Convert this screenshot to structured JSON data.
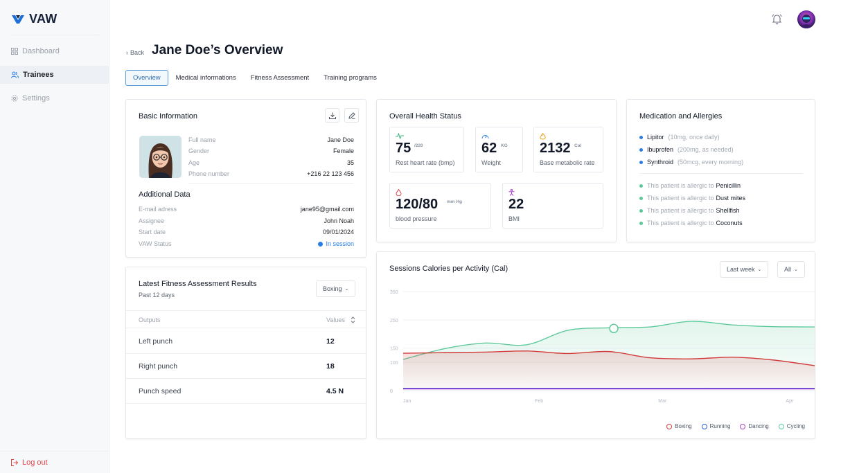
{
  "app": {
    "name": "VAW"
  },
  "sidebar": {
    "items": [
      {
        "label": "Dashboard",
        "icon": "grid-icon",
        "active": false
      },
      {
        "label": "Trainees",
        "icon": "users-icon",
        "active": true
      },
      {
        "label": "Settings",
        "icon": "gear-icon",
        "active": false
      }
    ],
    "logout": "Log out"
  },
  "header": {
    "back": "Back",
    "title": "Jane Doe’s Overview"
  },
  "tabs": [
    "Overview",
    "Medical informations",
    "Fitness Assessment",
    "Training programs"
  ],
  "basic_info": {
    "title": "Basic Information",
    "fields": [
      {
        "k": "Full name",
        "v": "Jane Doe"
      },
      {
        "k": "Gender",
        "v": "Female"
      },
      {
        "k": "Age",
        "v": "35"
      },
      {
        "k": "Phone number",
        "v": "+216 22 123 456"
      }
    ],
    "additional_title": "Additional Data",
    "additional": [
      {
        "k": "E-mail adress",
        "v": "jane95@gmail.com"
      },
      {
        "k": "Assignee",
        "v": "John Noah"
      },
      {
        "k": "Start date",
        "v": "09/01/2024"
      },
      {
        "k": "VAW Status",
        "v": "In session"
      }
    ]
  },
  "health": {
    "title": "Overall Health Status",
    "metrics": [
      {
        "value": "75",
        "unit": "/220",
        "label": "Rest heart rate (bmp)",
        "icon": "heartbeat-icon",
        "color": "#3bb57a"
      },
      {
        "value": "62",
        "unit": "KG",
        "label": "Weight",
        "icon": "gauge-icon",
        "color": "#2a7de1"
      },
      {
        "value": "2132",
        "unit": "Cal",
        "label": "Base metabolic rate",
        "icon": "flame-icon",
        "color": "#f0a020"
      },
      {
        "value": "120/80",
        "unit": "mm Hg",
        "label": "blood pressure",
        "icon": "drop-icon",
        "color": "#e0464a"
      },
      {
        "value": "22",
        "unit": "",
        "label": "BMI",
        "icon": "person-icon",
        "color": "#b044d0"
      }
    ]
  },
  "medication": {
    "title": "Medication and Allergies",
    "meds": [
      {
        "name": "Lipitor",
        "note": "(10mg, once daily)"
      },
      {
        "name": "Ibuprofen",
        "note": "(200mg, as needed)"
      },
      {
        "name": "Synthroid",
        "note": "(50mcg, every morning)"
      }
    ],
    "allergy_prefix": "This patient is allergic to",
    "allergies": [
      "Penicillin",
      "Dust mites",
      "Shellfish",
      "Coconuts"
    ]
  },
  "fitness": {
    "title": "Latest Fitness Assessment Results",
    "subtitle": "Past 12 days",
    "filter": "Boxing",
    "col_outputs": "Outputs",
    "col_values": "Values",
    "rows": [
      {
        "o": "Left punch",
        "v": "12"
      },
      {
        "o": "Right punch",
        "v": "18"
      },
      {
        "o": "Punch speed",
        "v": "4.5 N"
      }
    ]
  },
  "sessions": {
    "title": "Sessions Calories per Activity (Cal)",
    "period": "Last week",
    "activity": "All"
  },
  "chart_data": {
    "type": "area",
    "title": "Sessions Calories per Activity (Cal)",
    "x_ticks": [
      "Jan",
      "Feb",
      "Mar",
      "Apr"
    ],
    "y_ticks": [
      0,
      100,
      150,
      250,
      350
    ],
    "ylim": [
      0,
      350
    ],
    "x": [
      0,
      0.1,
      0.2,
      0.3,
      0.4,
      0.5,
      0.6,
      0.7,
      0.8,
      0.9,
      1.0
    ],
    "series": [
      {
        "name": "Boxing",
        "color": "#d23b3b",
        "values": [
          132,
          134,
          136,
          140,
          131,
          138,
          116,
          112,
          118,
          108,
          88
        ]
      },
      {
        "name": "Running",
        "color": "#2a5bd7",
        "values": [
          8,
          8,
          8,
          8,
          8,
          8,
          8,
          8,
          8,
          8,
          8
        ]
      },
      {
        "name": "Dancing",
        "color": "#b044d0",
        "values": [
          6,
          6,
          6,
          6,
          6,
          6,
          6,
          6,
          6,
          6,
          6
        ]
      },
      {
        "name": "Cycling",
        "color": "#5dc99a",
        "values": [
          110,
          148,
          168,
          162,
          213,
          222,
          225,
          245,
          232,
          226,
          225
        ]
      }
    ],
    "grid": true,
    "legend": "bottom-right"
  }
}
